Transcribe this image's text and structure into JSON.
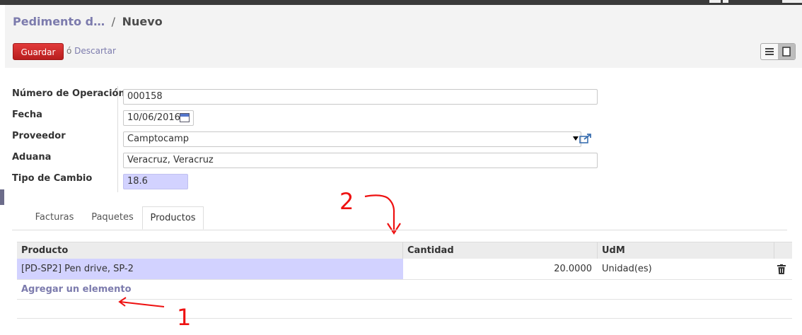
{
  "breadcrumb": {
    "parent": "Pedimento d…",
    "separator": "/",
    "current": "Nuevo"
  },
  "actions": {
    "save_label": "Guardar",
    "or_label": "ó",
    "discard_label": "Descartar"
  },
  "view_switcher": {
    "list_icon": "list-icon",
    "form_icon": "form-icon",
    "active": "form"
  },
  "form": {
    "fields": [
      {
        "label": "Número de Operación",
        "value": "000158"
      },
      {
        "label": "Fecha",
        "value": "10/06/2016"
      },
      {
        "label": "Proveedor",
        "value": "Camptocamp"
      },
      {
        "label": "Aduana",
        "value": "Veracruz, Veracruz"
      },
      {
        "label": "Tipo de Cambio",
        "value": "18.6"
      }
    ]
  },
  "tabs": [
    {
      "label": "Facturas",
      "active": false
    },
    {
      "label": "Paquetes",
      "active": false
    },
    {
      "label": "Productos",
      "active": true
    }
  ],
  "grid": {
    "columns": [
      "Producto",
      "Cantidad",
      "UdM"
    ],
    "rows": [
      {
        "product": "[PD-SP2] Pen drive, SP-2",
        "quantity": "20.0000",
        "uom": "Unidad(es)"
      }
    ],
    "add_item_label": "Agregar un elemento"
  },
  "annotations": {
    "one": "1",
    "two": "2",
    "color": "#ee1111"
  },
  "colors": {
    "save_button": "#c62828",
    "link": "#7c7bad",
    "required_field": "#d2d2ff"
  }
}
